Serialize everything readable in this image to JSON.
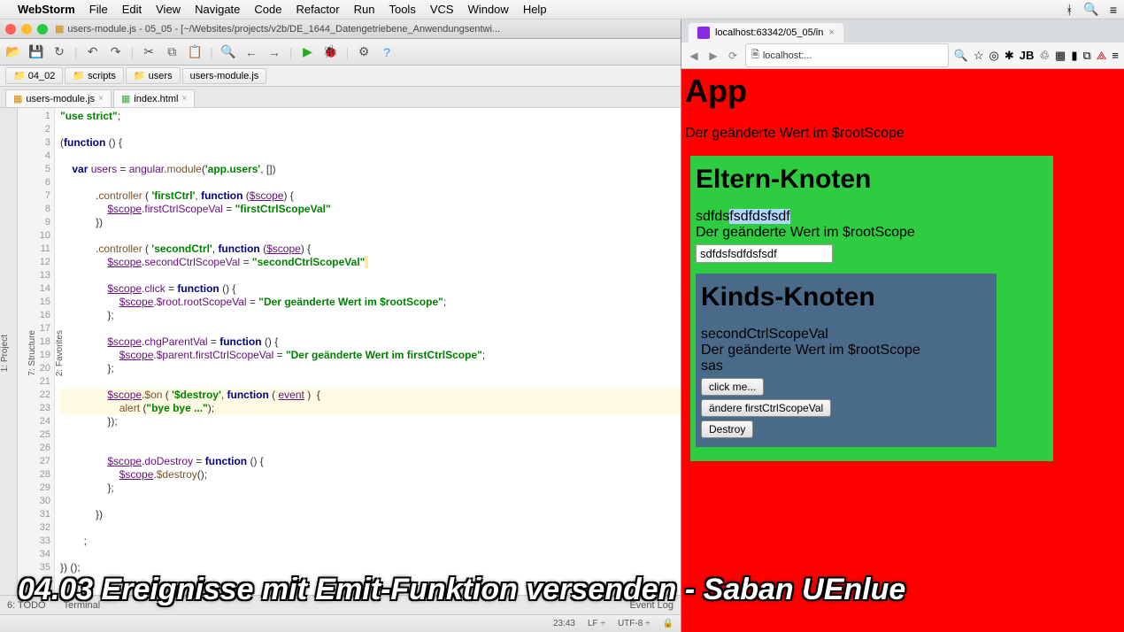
{
  "menubar": {
    "app": "WebStorm",
    "items": [
      "File",
      "Edit",
      "View",
      "Navigate",
      "Code",
      "Refactor",
      "Run",
      "Tools",
      "VCS",
      "Window",
      "Help"
    ]
  },
  "window_title": "users-module.js - 05_05 - [~/Websites/projects/v2b/DE_1644_Datengetriebene_Anwendungsentwi...",
  "breadcrumbs": [
    "04_02",
    "scripts",
    "users",
    "users-module.js"
  ],
  "tabs": [
    {
      "label": "users-module.js",
      "icon": "js"
    },
    {
      "label": "index.html",
      "icon": "html"
    }
  ],
  "side_tabs": [
    "1: Project",
    "7: Structure",
    "2: Favorites"
  ],
  "code_lines": [
    {
      "n": 1,
      "html": "<span class='str'>\"use strict\"</span>;"
    },
    {
      "n": 2,
      "html": ""
    },
    {
      "n": 3,
      "html": "(<span class='kw'>function</span> () {"
    },
    {
      "n": 4,
      "html": ""
    },
    {
      "n": 5,
      "html": "    <span class='kw'>var</span> <span class='ident'>users</span> = <span class='ident'>angular</span>.<span class='fn'>module</span>(<span class='str'>'app.users'</span>, [])"
    },
    {
      "n": 6,
      "html": ""
    },
    {
      "n": 7,
      "html": "            .<span class='fn'>controller</span> ( <span class='str'>'firstCtrl'</span>, <span class='kw'>function</span> (<span class='var-u'>$scope</span>) {"
    },
    {
      "n": 8,
      "html": "                <span class='var-u'>$scope</span>.<span class='ident'>firstCtrlScopeVal</span> = <span class='str'>\"firstCtrlScopeVal\"</span>"
    },
    {
      "n": 9,
      "html": "            })"
    },
    {
      "n": 10,
      "html": ""
    },
    {
      "n": 11,
      "html": "            .<span class='fn'>controller</span> ( <span class='str'>'secondCtrl'</span>, <span class='kw'>function</span> (<span class='var-u'>$scope</span>) {"
    },
    {
      "n": 12,
      "html": "                <span class='var-u'>$scope</span>.<span class='ident'>secondCtrlScopeVal</span> = <span class='str'>\"secondCtrlScopeVal\"</span><span class='caret-mark'> </span>"
    },
    {
      "n": 13,
      "html": ""
    },
    {
      "n": 14,
      "html": "                <span class='var-u'>$scope</span>.<span class='ident'>click</span> = <span class='kw'>function</span> () {"
    },
    {
      "n": 15,
      "html": "                    <span class='var-u'>$scope</span>.<span class='ident'>$root</span>.<span class='ident'>rootScopeVal</span> = <span class='str'>\"Der geänderte Wert im $rootScope\"</span>;"
    },
    {
      "n": 16,
      "html": "                };"
    },
    {
      "n": 17,
      "html": ""
    },
    {
      "n": 18,
      "html": "                <span class='var-u'>$scope</span>.<span class='ident'>chgParentVal</span> = <span class='kw'>function</span> () {"
    },
    {
      "n": 19,
      "html": "                    <span class='var-u'>$scope</span>.<span class='ident'>$parent</span>.<span class='ident'>firstCtrlScopeVal</span> = <span class='str'>\"Der geänderte Wert im firstCtrlScope\"</span>;"
    },
    {
      "n": 20,
      "html": "                };"
    },
    {
      "n": 21,
      "html": ""
    },
    {
      "n": 22,
      "html": "                <span class='var-u'>$scope</span>.<span class='fn'>$on</span> ( <span class='str'>'$destroy'</span>, <span class='kw'>function</span> ( <span class='var-u'>event</span> )  {",
      "hl": true
    },
    {
      "n": 23,
      "html": "                    <span class='fn'>alert</span> (<span class='str'>\"bye bye ...\"</span>);",
      "hl": true
    },
    {
      "n": 24,
      "html": "                });"
    },
    {
      "n": 25,
      "html": ""
    },
    {
      "n": 26,
      "html": ""
    },
    {
      "n": 27,
      "html": "                <span class='var-u'>$scope</span>.<span class='ident'>doDestroy</span> = <span class='kw'>function</span> () {"
    },
    {
      "n": 28,
      "html": "                    <span class='var-u'>$scope</span>.<span class='fn'>$destroy</span>();"
    },
    {
      "n": 29,
      "html": "                };"
    },
    {
      "n": 30,
      "html": ""
    },
    {
      "n": 31,
      "html": "            })"
    },
    {
      "n": 32,
      "html": ""
    },
    {
      "n": 33,
      "html": "        ;"
    },
    {
      "n": 34,
      "html": ""
    },
    {
      "n": 35,
      "html": "}) ();"
    }
  ],
  "bottom_tabs": {
    "left": [
      "6: TODO",
      "Terminal"
    ],
    "right": "Event Log"
  },
  "status": {
    "pos": "23:43",
    "lf": "LF ÷",
    "enc": "UTF-8 ÷",
    "lock": "🔒"
  },
  "chrome": {
    "tab_title": "localhost:63342/05_05/in",
    "url": "localhost:..."
  },
  "page": {
    "h1": "App",
    "root_val": "Der geänderte Wert im $rootScope",
    "parent": {
      "title": "Eltern-Knoten",
      "line1_a": "sdfds",
      "line1_b": "fsdfdsfsdf",
      "line2": "Der geänderte Wert im $rootScope",
      "input_val": "sdfdsfsdfdsfsdf"
    },
    "child": {
      "title": "Kinds-Knoten",
      "line1": "secondCtrlScopeVal",
      "line2": "Der geänderte Wert im $rootScope",
      "line3": "sas",
      "btn1": "click me...",
      "btn2": "ändere firstCtrlScopeVal",
      "btn3": "Destroy"
    }
  },
  "caption": "04.03 Ereignisse mit Emit-Funktion versenden - Saban UEnlue"
}
